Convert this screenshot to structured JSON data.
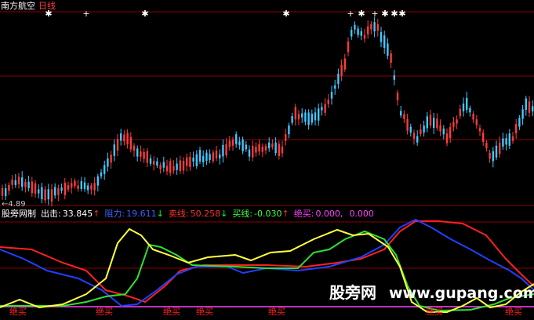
{
  "header": {
    "stock_name": "南方航空",
    "period": "日线"
  },
  "price_panel": {
    "low_label": "←4.89",
    "colors": {
      "up": "#ff3b3b",
      "down": "#40c8ff",
      "grid": "#8b0000"
    }
  },
  "indicator": {
    "name": "股旁网制",
    "items": [
      {
        "label": "出击:",
        "value": "33.845",
        "arrow": "↑",
        "label_color": "#ffffff",
        "value_color": "#ffffff",
        "arrow_color": "#ff3030"
      },
      {
        "label": "阻力:",
        "value": "19.611",
        "arrow": "↓",
        "label_color": "#4060ff",
        "value_color": "#4060ff",
        "arrow_color": "#00ff40"
      },
      {
        "label": "卖线:",
        "value": "50.258",
        "arrow": "↓",
        "label_color": "#ff3030",
        "value_color": "#ff3030",
        "arrow_color": "#00ff40"
      },
      {
        "label": "买线:",
        "value": "-0.030",
        "arrow": "↑",
        "label_color": "#40ff40",
        "value_color": "#40ff40",
        "arrow_color": "#ff3030"
      },
      {
        "label": "绝买:",
        "value": "0.000,",
        "arrow": "",
        "label_color": "#ff40ff",
        "value_color": "#ff40ff",
        "arrow_color": "#ff40ff"
      },
      {
        "label": "",
        "value": "0.000",
        "arrow": "",
        "label_color": "#ff40ff",
        "value_color": "#ff40ff",
        "arrow_color": "#ff40ff"
      }
    ],
    "signal_labels": [
      "绝买",
      "绝买",
      "绝买",
      "绝买",
      "绝买",
      "绝买",
      "绝买"
    ]
  },
  "watermark": {
    "cn": "股旁网",
    "url": "www.gupang.com"
  }
}
